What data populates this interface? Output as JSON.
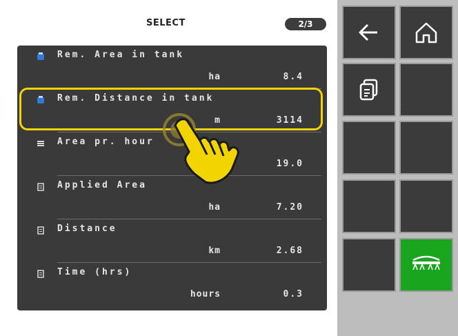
{
  "header": {
    "title": "SELECT",
    "page_indicator": "2/3"
  },
  "rows": [
    {
      "name": "Rem. Area in tank",
      "unit": "ha",
      "value": "8.4",
      "icon": "tank-icon"
    },
    {
      "name": "Rem. Distance in tank",
      "unit": "m",
      "value": "3114",
      "icon": "tank-icon",
      "selected": true
    },
    {
      "name": "Area  pr. hour",
      "unit": "",
      "value": "19.0",
      "icon": "rate-icon"
    },
    {
      "name": "Applied Area",
      "unit": "ha",
      "value": "7.20",
      "icon": "clipboard-icon"
    },
    {
      "name": "Distance",
      "unit": "km",
      "value": "2.68",
      "icon": "clipboard-icon"
    },
    {
      "name": "Time (hrs)",
      "unit": "hours",
      "value": "0.3",
      "icon": "clipboard-icon"
    }
  ],
  "side_buttons": [
    {
      "name": "back-button",
      "icon": "arrow-left-icon"
    },
    {
      "name": "home-button",
      "icon": "home-icon"
    },
    {
      "name": "copy-button",
      "icon": "copy-icon"
    },
    {
      "name": "empty-button-1",
      "icon": ""
    },
    {
      "name": "empty-button-2",
      "icon": ""
    },
    {
      "name": "empty-button-3",
      "icon": ""
    },
    {
      "name": "empty-button-4",
      "icon": ""
    },
    {
      "name": "empty-button-5",
      "icon": ""
    },
    {
      "name": "empty-button-6",
      "icon": ""
    },
    {
      "name": "sprayer-boom-button",
      "icon": "sprayer-boom-icon",
      "active": true
    }
  ],
  "colors": {
    "list_bg": "#3a3a3a",
    "highlight": "#f2d400",
    "active_button": "#1aa51f"
  }
}
